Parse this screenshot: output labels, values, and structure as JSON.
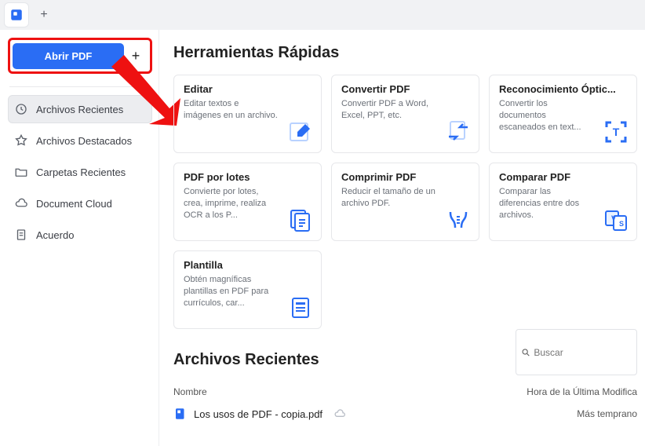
{
  "colors": {
    "accent": "#2a6df4",
    "annotation": "#e11"
  },
  "header": {
    "open_label": "Abrir PDF"
  },
  "sidebar": {
    "items": [
      {
        "label": "Archivos Recientes",
        "icon": "clock-icon",
        "active": true
      },
      {
        "label": "Archivos Destacados",
        "icon": "star-icon"
      },
      {
        "label": "Carpetas Recientes",
        "icon": "folder-icon"
      },
      {
        "label": "Document Cloud",
        "icon": "cloud-icon"
      },
      {
        "label": "Acuerdo",
        "icon": "doc-icon"
      }
    ]
  },
  "quick_tools": {
    "title": "Herramientas Rápidas",
    "cards": [
      {
        "title": "Editar",
        "desc": "Editar textos e imágenes en un archivo."
      },
      {
        "title": "Convertir PDF",
        "desc": "Convertir PDF a Word, Excel, PPT, etc."
      },
      {
        "title": "Reconocimiento Óptic...",
        "desc": "Convertir los documentos escaneados en text..."
      },
      {
        "title": "PDF por lotes",
        "desc": "Convierte por lotes, crea, imprime, realiza OCR a los P..."
      },
      {
        "title": "Comprimir PDF",
        "desc": "Reducir el tamaño de un archivo PDF."
      },
      {
        "title": "Comparar PDF",
        "desc": "Comparar las diferencias entre dos archivos."
      },
      {
        "title": "Plantilla",
        "desc": "Obtén magníficas plantillas en PDF para currículos, car..."
      }
    ]
  },
  "recent": {
    "title": "Archivos Recientes",
    "search_placeholder": "Buscar",
    "col_name": "Nombre",
    "col_time": "Hora de la Última Modifica",
    "rows": [
      {
        "name": "Los usos de PDF - copia.pdf",
        "mtime": "Más temprano"
      }
    ]
  }
}
